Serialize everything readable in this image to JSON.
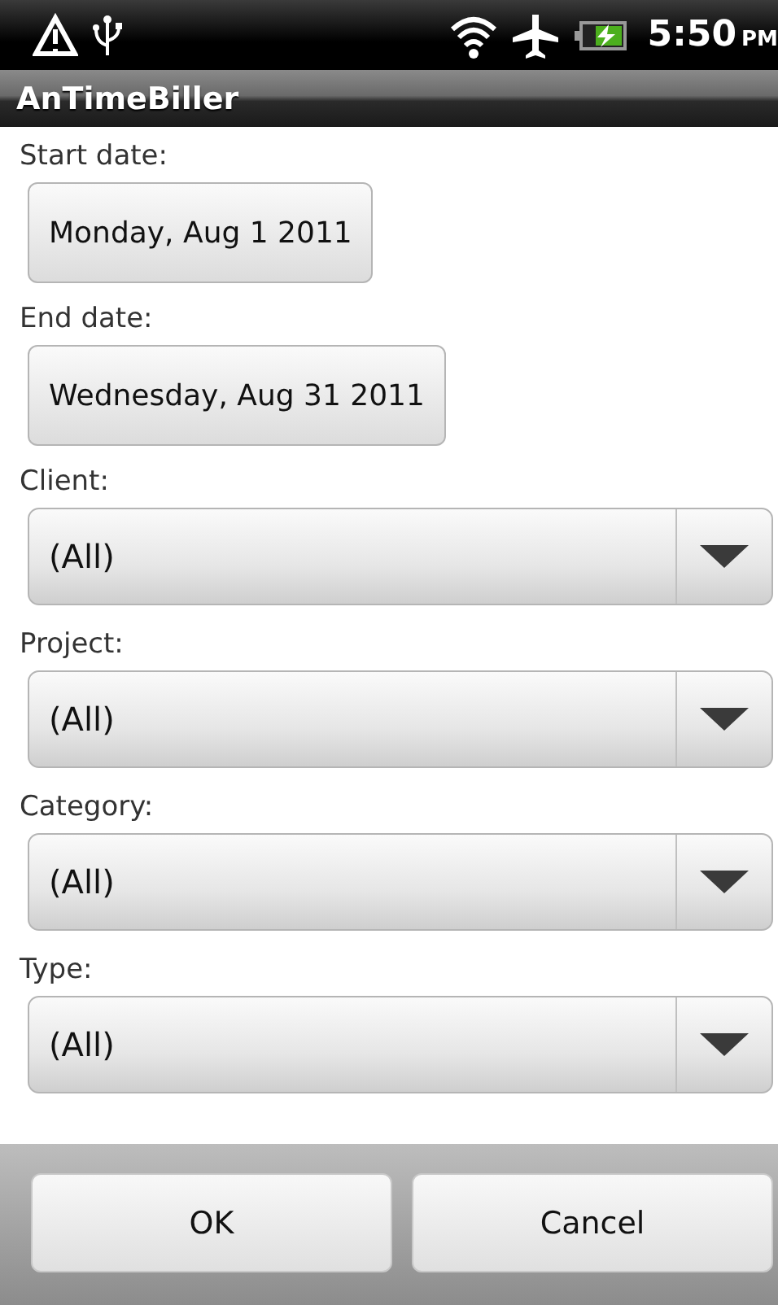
{
  "status_bar": {
    "time": "5:50",
    "ampm": "PM"
  },
  "window": {
    "title": "AnTimeBiller"
  },
  "fields": [
    {
      "kind": "date",
      "label": "Start date:",
      "value": "Monday, Aug 1 2011"
    },
    {
      "kind": "date",
      "label": "End date:",
      "value": "Wednesday, Aug 31 2011"
    },
    {
      "kind": "spinner",
      "label": "Client:",
      "value": "(All)"
    },
    {
      "kind": "spinner",
      "label": "Project:",
      "value": "(All)"
    },
    {
      "kind": "spinner",
      "label": "Category:",
      "value": "(All)"
    },
    {
      "kind": "spinner",
      "label": "Type:",
      "value": "(All)"
    }
  ],
  "buttons": [
    "OK",
    "Cancel"
  ]
}
